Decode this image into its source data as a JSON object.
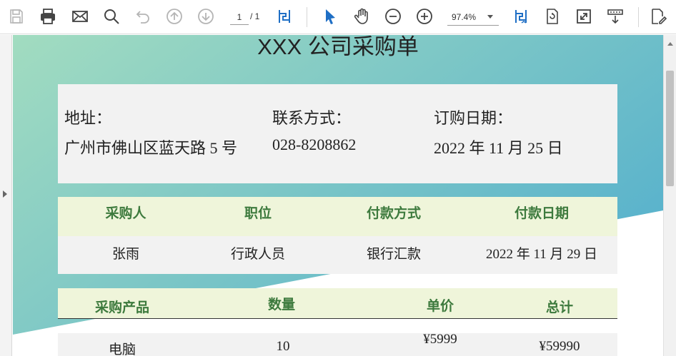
{
  "toolbar": {
    "items": [
      "save-icon",
      "print-icon",
      "email-icon",
      "search-icon",
      "undo-icon",
      "prev-page-icon",
      "next-page-icon",
      "fit-page-icon",
      "select-icon",
      "hand-icon",
      "zoom-out-icon",
      "zoom-in-icon",
      "fit-width-icon",
      "rotate-icon",
      "fullscreen-icon",
      "scroll-mode-icon",
      "edit-icon"
    ],
    "page_current": "1",
    "page_total": "/ 1",
    "zoom": "97.4%"
  },
  "colors": {
    "teal_light": "#a2dcc0",
    "teal_dark": "#5ab3cc",
    "header_green": "#3d7a3d",
    "header_bg": "#eff5da",
    "row_bg": "#f2f2f2",
    "accent_blue": "#1f6fc5"
  },
  "document": {
    "title": "XXX 公司采购单",
    "info": {
      "address_label": "地址：",
      "address_value": "广州市佛山区蓝天路 5 号",
      "contact_label": "联系方式：",
      "contact_value": "028-8208862",
      "date_label": "订购日期：",
      "date_value": "2022 年 11 月 25 日"
    },
    "purchase_info": {
      "headers": [
        "采购人",
        "职位",
        "付款方式",
        "付款日期"
      ],
      "row": [
        "张雨",
        "行政人员",
        "银行汇款",
        "2022 年 11 月 29 日"
      ]
    },
    "products": {
      "headers": [
        "采购产品",
        "数量",
        "单价",
        "总计"
      ],
      "rows": [
        [
          "电脑",
          "10",
          "¥5999",
          "¥59990"
        ]
      ]
    }
  }
}
